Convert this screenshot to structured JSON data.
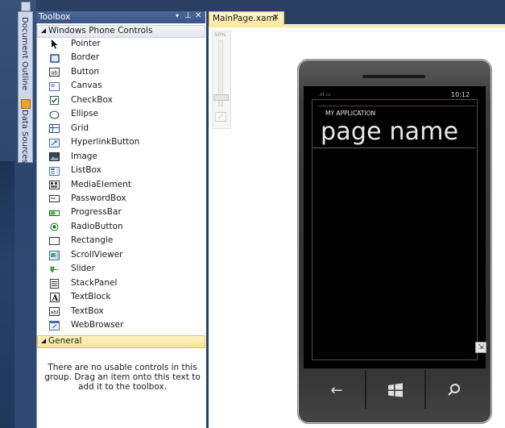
{
  "toolbox": {
    "title": "Toolbox",
    "groups": [
      {
        "name": "Windows Phone Controls"
      },
      {
        "name": "General"
      }
    ],
    "items": [
      {
        "label": "Pointer",
        "icon": "pointer-icon"
      },
      {
        "label": "Border",
        "icon": "border-icon"
      },
      {
        "label": "Button",
        "icon": "button-icon"
      },
      {
        "label": "Canvas",
        "icon": "canvas-icon"
      },
      {
        "label": "CheckBox",
        "icon": "checkbox-icon"
      },
      {
        "label": "Ellipse",
        "icon": "ellipse-icon"
      },
      {
        "label": "Grid",
        "icon": "grid-icon"
      },
      {
        "label": "HyperlinkButton",
        "icon": "hyperlinkbutton-icon"
      },
      {
        "label": "Image",
        "icon": "image-icon"
      },
      {
        "label": "ListBox",
        "icon": "listbox-icon"
      },
      {
        "label": "MediaElement",
        "icon": "mediaelement-icon"
      },
      {
        "label": "PasswordBox",
        "icon": "passwordbox-icon"
      },
      {
        "label": "ProgressBar",
        "icon": "progressbar-icon"
      },
      {
        "label": "RadioButton",
        "icon": "radiobutton-icon"
      },
      {
        "label": "Rectangle",
        "icon": "rectangle-icon"
      },
      {
        "label": "ScrollViewer",
        "icon": "scrollviewer-icon"
      },
      {
        "label": "Slider",
        "icon": "slider-icon"
      },
      {
        "label": "StackPanel",
        "icon": "stackpanel-icon"
      },
      {
        "label": "TextBlock",
        "icon": "textblock-icon"
      },
      {
        "label": "TextBox",
        "icon": "textbox-icon"
      },
      {
        "label": "WebBrowser",
        "icon": "webbrowser-icon"
      }
    ],
    "general_empty_text": "There are no usable controls in this group. Drag an item onto this text to add it to the toolbox."
  },
  "side_tabs": {
    "document_outline": "Document Outline",
    "data_sources": "Data Sources"
  },
  "document": {
    "tab_label": "MainPage.xaml",
    "zoom_label": "50%"
  },
  "phone": {
    "time": "10:12",
    "app_title": "MY APPLICATION",
    "page_name": "page name"
  },
  "colors": {
    "ide_background": "#2a3f62",
    "toolbox_title_bar": "#3a5585",
    "active_tab": "#fde99a",
    "phone_screen": "#000000"
  }
}
